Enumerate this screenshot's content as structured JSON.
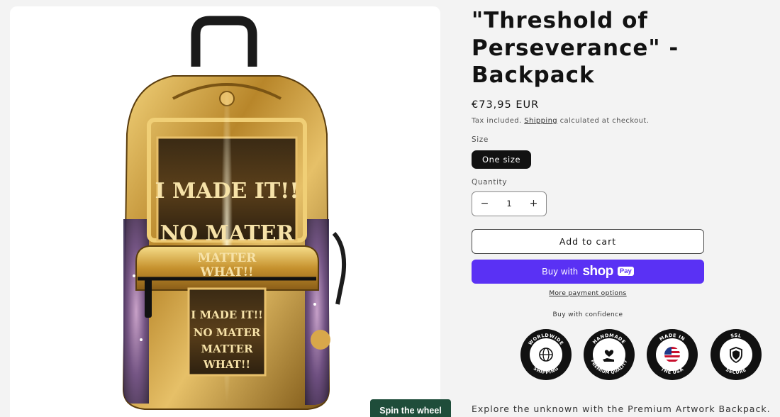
{
  "product": {
    "title": "\"Threshold of Perseverance\" - Backpack",
    "price": "€73,95 EUR",
    "tax_prefix": "Tax included.",
    "tax_link": "Shipping",
    "tax_suffix": "calculated at checkout.",
    "size_label": "Size",
    "size_option": "One size",
    "quantity_label": "Quantity",
    "quantity_value": "1",
    "quantity_minus": "−",
    "quantity_plus": "+",
    "add_to_cart": "Add to cart",
    "shop_pay": {
      "prefix": "Buy with",
      "brand": "shop",
      "badge": "Pay"
    },
    "more_payment": "More payment options",
    "confidence": "Buy with confidence",
    "description": "Explore the unknown with the Premium Artwork Backpack."
  },
  "media": {
    "artwork_text": [
      "I MADE IT!!",
      "NO MATER",
      "MATTER",
      "WHAT!!"
    ]
  },
  "badges": [
    {
      "top": "WORLDWIDE",
      "bottom": "SHIPPING",
      "icon": "globe-icon"
    },
    {
      "top": "HANDMADE",
      "bottom": "PREMIUM QUALITY",
      "icon": "hand-heart-icon"
    },
    {
      "top": "MADE IN",
      "bottom": "THE USA",
      "icon": "us-flag-icon"
    },
    {
      "top": "SSL",
      "bottom": "SECURE",
      "icon": "shield-icon"
    }
  ],
  "spin_wheel": "Spin the wheel",
  "colors": {
    "accent": "#5a31f4",
    "spin": "#1f4d3a",
    "text": "#121212"
  }
}
